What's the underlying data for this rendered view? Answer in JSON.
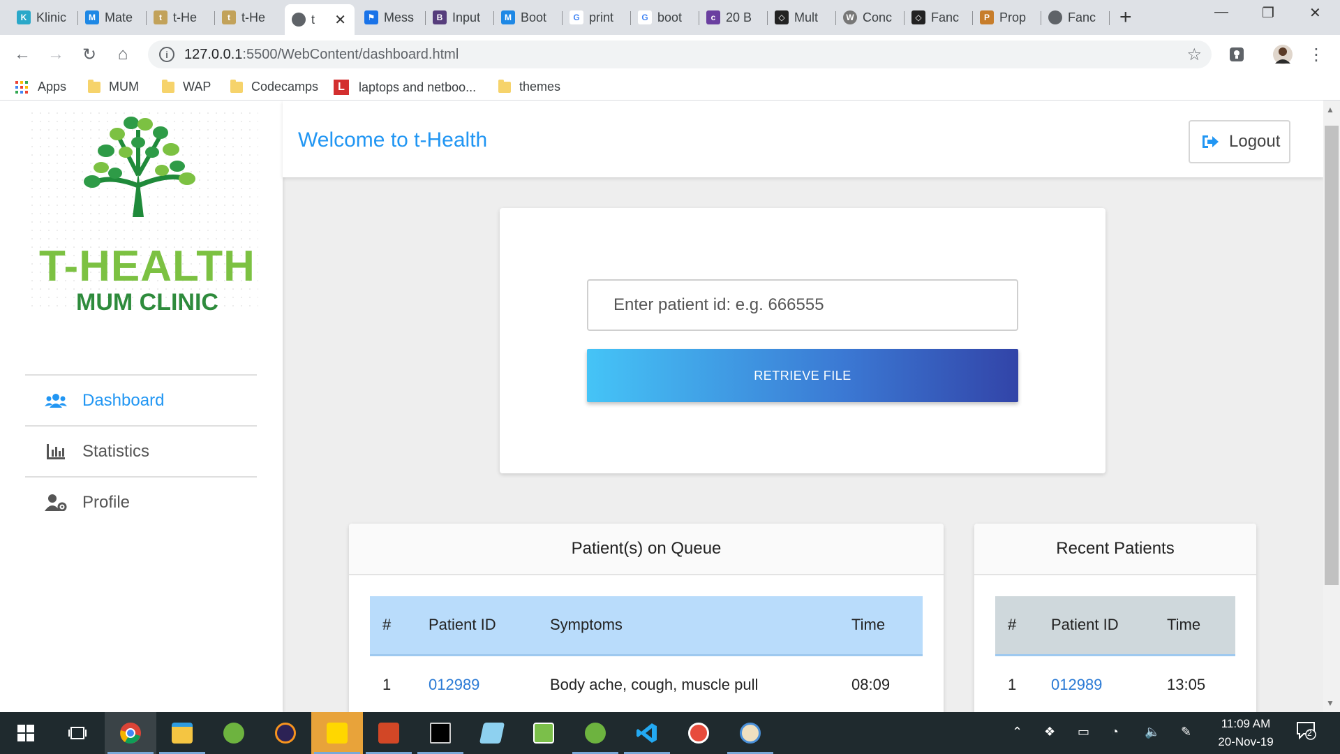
{
  "browser": {
    "tabs": [
      {
        "label": "Klinic",
        "icon": "klinic-icon",
        "color": "#2aa8c9"
      },
      {
        "label": "Mate",
        "icon": "mdb-icon",
        "color": "#1e88e5"
      },
      {
        "label": "t-He",
        "icon": "thealth-icon",
        "color": "#c2a25a"
      },
      {
        "label": "t-He",
        "icon": "thealth-icon",
        "color": "#c2a25a"
      },
      {
        "label": "t",
        "icon": "globe-icon",
        "color": "#5f6368"
      },
      {
        "label": "Mess",
        "icon": "flag-icon",
        "color": "#1a73e8"
      },
      {
        "label": "Input",
        "icon": "bootstrap-icon",
        "color": "#563d7c"
      },
      {
        "label": "Boot",
        "icon": "mdb-icon",
        "color": "#1e88e5"
      },
      {
        "label": "print",
        "icon": "google-icon",
        "color": "#4285f4"
      },
      {
        "label": "boot",
        "icon": "google-icon",
        "color": "#4285f4"
      },
      {
        "label": "20 B",
        "icon": "colorlib-icon",
        "color": "#6a3fa0"
      },
      {
        "label": "Mult",
        "icon": "codepen-icon",
        "color": "#222222"
      },
      {
        "label": "Conc",
        "icon": "wordpress-icon",
        "color": "#777777"
      },
      {
        "label": "Fanc",
        "icon": "codepen-icon",
        "color": "#222222"
      },
      {
        "label": "Prop",
        "icon": "prop-icon",
        "color": "#c77d2b"
      },
      {
        "label": "Fanc",
        "icon": "globe-icon",
        "color": "#5f6368"
      }
    ],
    "url_host": "127.0.0.1",
    "url_rest": ":5500/WebContent/dashboard.html",
    "bookmarks": [
      {
        "label": "Apps",
        "icon": "apps-grid-icon"
      },
      {
        "label": "MUM",
        "icon": "folder-icon"
      },
      {
        "label": "WAP",
        "icon": "folder-icon"
      },
      {
        "label": "Codecamps",
        "icon": "folder-icon"
      },
      {
        "label": "laptops and netboo...",
        "icon": "l-badge-icon"
      },
      {
        "label": "themes",
        "icon": "folder-icon"
      }
    ]
  },
  "sidebar": {
    "logo_title": "T-HEALTH",
    "logo_subtitle": "MUM CLINIC",
    "items": [
      {
        "label": "Dashboard",
        "icon": "users-icon",
        "active": true
      },
      {
        "label": "Statistics",
        "icon": "bar-chart-icon",
        "active": false
      },
      {
        "label": "Profile",
        "icon": "user-gear-icon",
        "active": false
      }
    ]
  },
  "header": {
    "welcome": "Welcome to t-Health",
    "logout_label": "Logout"
  },
  "search": {
    "placeholder": "Enter patient id: e.g. 666555",
    "button_label": "RETRIEVE FILE"
  },
  "queue": {
    "title": "Patient(s) on Queue",
    "columns": [
      "#",
      "Patient ID",
      "Symptoms",
      "Time"
    ],
    "rows": [
      {
        "num": "1",
        "patient_id": "012989",
        "symptoms": "Body ache, cough, muscle pull",
        "time": "08:09"
      }
    ]
  },
  "recent": {
    "title": "Recent Patients",
    "columns": [
      "#",
      "Patient ID",
      "Time"
    ],
    "rows": [
      {
        "num": "1",
        "patient_id": "012989",
        "time": "13:05"
      }
    ]
  },
  "taskbar": {
    "time": "11:09 AM",
    "date": "20-Nov-19",
    "notification_count": "2"
  },
  "colors": {
    "accent": "#2196f3",
    "logo_green": "#7cc142",
    "queue_header": "#b9dcfb",
    "recent_header": "#cfd8dc"
  }
}
